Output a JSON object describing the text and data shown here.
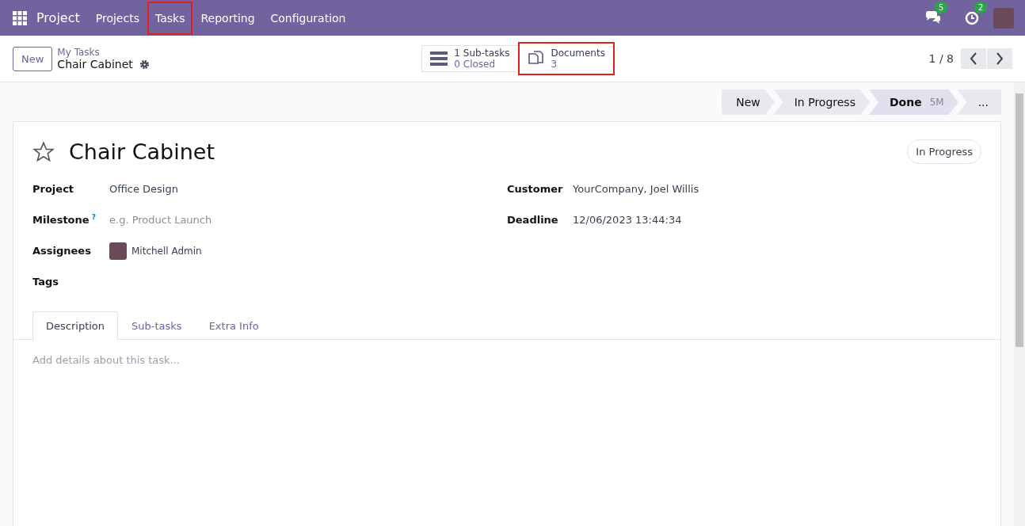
{
  "navbar": {
    "app_name": "Project",
    "menu": [
      {
        "label": "Projects",
        "highlighted": false
      },
      {
        "label": "Tasks",
        "highlighted": true
      },
      {
        "label": "Reporting",
        "highlighted": false
      },
      {
        "label": "Configuration",
        "highlighted": false
      }
    ],
    "messages_badge": "5",
    "activities_badge": "2"
  },
  "control_panel": {
    "new_button": "New",
    "breadcrumb_parent": "My Tasks",
    "breadcrumb_current": "Chair Cabinet",
    "smart_buttons": [
      {
        "kind": "subtasks",
        "line_1": "1 Sub-tasks",
        "line_2": "0 Closed",
        "highlighted": false
      },
      {
        "kind": "documents",
        "line_1": "Documents",
        "line_2": "3",
        "highlighted": true
      }
    ],
    "pager": "1 / 8"
  },
  "stages": [
    {
      "label": "New",
      "selected": false
    },
    {
      "label": "In Progress",
      "selected": false
    },
    {
      "label": "Done",
      "selected": true,
      "note": "5M"
    },
    {
      "label": "...",
      "selected": false
    }
  ],
  "form": {
    "title": "Chair Cabinet",
    "starred": false,
    "status_pill": "In Progress",
    "left_fields": [
      {
        "label": "Project",
        "value": "Office Design"
      },
      {
        "label": "Milestone",
        "help": "?",
        "placeholder": "e.g. Product Launch"
      },
      {
        "label": "Assignees",
        "value": "Mitchell Admin",
        "avatar": true
      },
      {
        "label": "Tags"
      }
    ],
    "right_fields": [
      {
        "label": "Customer",
        "value": "YourCompany, Joel Willis"
      },
      {
        "label": "Deadline",
        "value": "12/06/2023 13:44:34"
      }
    ],
    "tabs": [
      {
        "label": "Description",
        "selected": true
      },
      {
        "label": "Sub-tasks",
        "selected": false
      },
      {
        "label": "Extra Info",
        "selected": false
      }
    ],
    "description_placeholder": "Add details about this task..."
  }
}
